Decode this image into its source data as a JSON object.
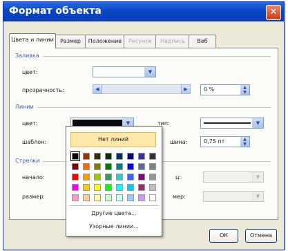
{
  "window": {
    "title": "Формат объекта",
    "close_glyph": "✕"
  },
  "tabs": [
    {
      "label": "Цвета и линии",
      "state": "active"
    },
    {
      "label": "Размер",
      "state": "normal"
    },
    {
      "label": "Положение",
      "state": "normal"
    },
    {
      "label": "Рисунок",
      "state": "disabled"
    },
    {
      "label": "Надпись",
      "state": "disabled"
    },
    {
      "label": "Веб",
      "state": "normal"
    }
  ],
  "fill": {
    "group_label": "Заливка",
    "color_label": "цвет:",
    "transparency_label": "прозрачность:",
    "transparency_value": "0 %"
  },
  "lines": {
    "group_label": "Линии",
    "color_label": "цвет:",
    "color_value": "#0a0a0a",
    "type_label": "тип:",
    "pattern_label": "шаблон:",
    "weight_label": "шина:",
    "weight_value": "0,75 пт"
  },
  "arrows": {
    "group_label": "Стрелки",
    "begin_label": "начало:",
    "size_label": "размер:",
    "end_label": "ц:",
    "end_size_label": "мер:"
  },
  "color_popup": {
    "no_line_label": "Нет линий",
    "more_colors_label": "Другие цвета...",
    "patterned_lines_label": "Узорные линии...",
    "selected_index": 0,
    "rows": [
      [
        "#000000",
        "#993300",
        "#333300",
        "#003300",
        "#003366",
        "#000080",
        "#333399",
        "#333333"
      ],
      [
        "#800000",
        "#ff6600",
        "#808000",
        "#008000",
        "#008080",
        "#0000ff",
        "#666699",
        "#808080"
      ],
      [
        "#ff0000",
        "#ff9900",
        "#99cc00",
        "#339966",
        "#33cccc",
        "#3366ff",
        "#800080",
        "#969696"
      ],
      [
        "#ff00ff",
        "#ffcc00",
        "#ffff00",
        "#00ff00",
        "#00ffff",
        "#00ccff",
        "#993366",
        "#c0c0c0"
      ],
      [
        "#ff99cc",
        "#ffcc99",
        "#ffff99",
        "#ccffcc",
        "#ccffff",
        "#99ccff",
        "#cc99ff",
        "#ffffff"
      ]
    ]
  },
  "buttons": {
    "ok": "ОК",
    "cancel": "Отмена"
  }
}
